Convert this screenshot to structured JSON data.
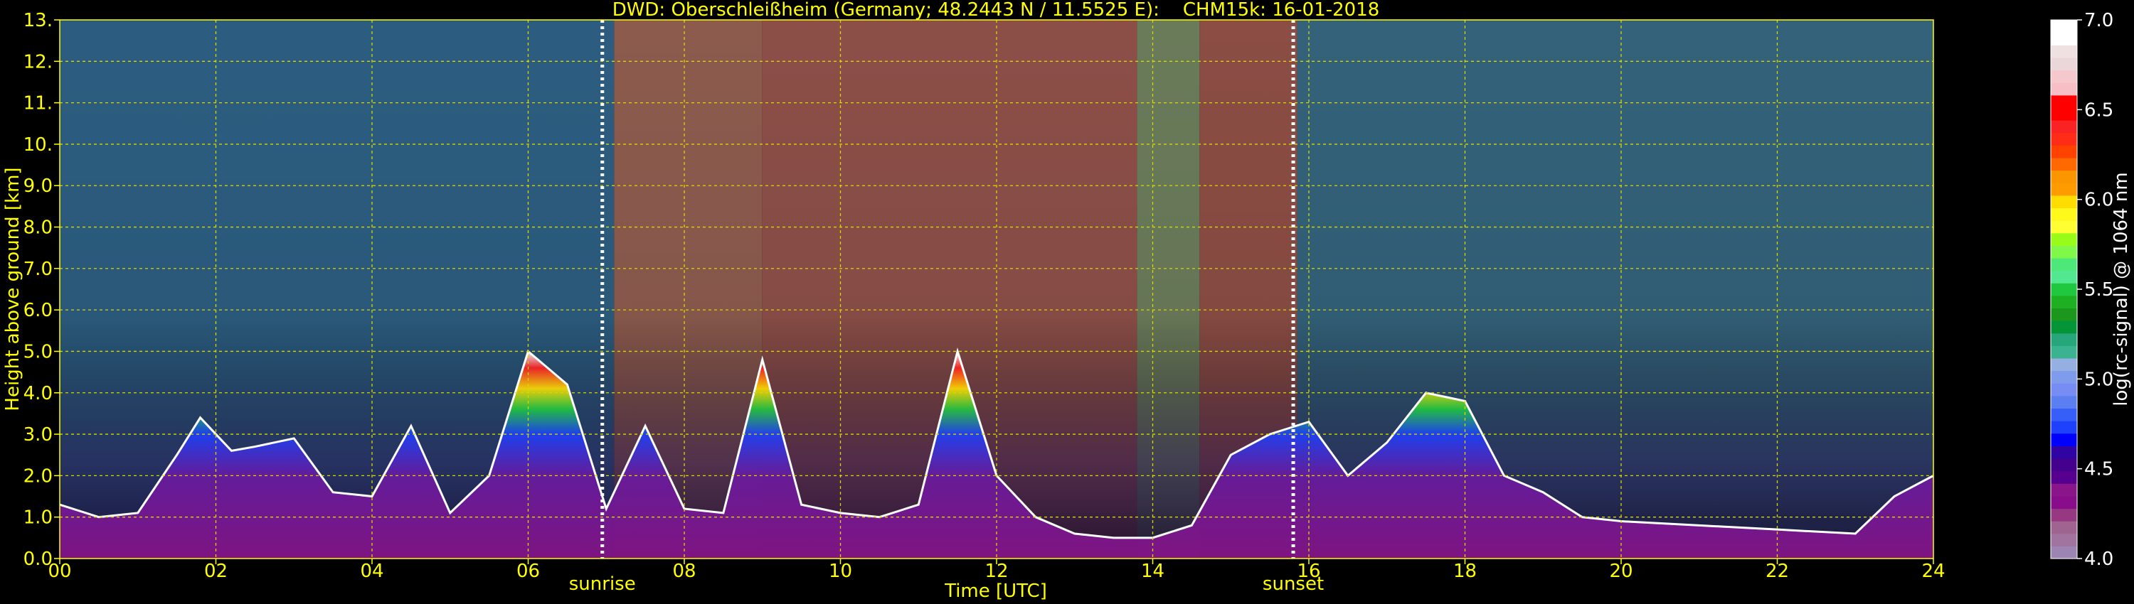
{
  "chart_data": {
    "type": "heatmap",
    "title": "DWD: Oberschleißheim (Germany; 48.2443 N / 11.5525 E):    CHM15k: 16-01-2018",
    "xlabel": "Time [UTC]",
    "ylabel": "Height above ground [km]",
    "xlim": [
      0,
      24
    ],
    "ylim": [
      0,
      13
    ],
    "x_ticks": [
      "00",
      "02",
      "04",
      "06",
      "08",
      "10",
      "12",
      "14",
      "16",
      "18",
      "20",
      "22",
      "24"
    ],
    "y_ticks": [
      "0.0",
      "1.0",
      "2.0",
      "3.0",
      "4.0",
      "5.0",
      "6.0",
      "7.0",
      "8.0",
      "9.0",
      "10.",
      "11.",
      "12.",
      "13."
    ],
    "grid": true,
    "annotations": [
      {
        "label": "sunrise",
        "x": 6.95
      },
      {
        "label": "sunset",
        "x": 15.8
      }
    ],
    "colorbar": {
      "label": "log(rc-signal) @ 1064 nm",
      "range": [
        4.0,
        7.0
      ],
      "ticks": [
        "4.0",
        "4.5",
        "5.0",
        "5.5",
        "6.0",
        "6.5",
        "7.0"
      ],
      "colors": [
        "#9c85b4",
        "#a1749f",
        "#a06490",
        "#973883",
        "#880d8a",
        "#8a148a",
        "#57008f",
        "#44018d",
        "#2f04a2",
        "#0000ff",
        "#1d41fd",
        "#365ffa",
        "#5b7ff0",
        "#778df3",
        "#7f9beb",
        "#95afe2",
        "#3bb391",
        "#27a57b",
        "#039537",
        "#1b971d",
        "#1eaf22",
        "#20c840",
        "#51e88f",
        "#4de877",
        "#80f84a",
        "#99fb18",
        "#ffff33",
        "#fff81a",
        "#ffdd00",
        "#fe9b00",
        "#fb9600",
        "#ff6900",
        "#ff4200",
        "#ff2c17",
        "#fa2222",
        "#ff0000",
        "#ff0000",
        "#f7bfc5",
        "#f5c8cd",
        "#ebd7d9",
        "#efe1e1",
        "#ffffff",
        "#ffffff"
      ]
    },
    "background_regimes": [
      {
        "from": 0,
        "to": 7.1,
        "color": "#2c5d80"
      },
      {
        "from": 7.1,
        "to": 9.0,
        "color": "#8c5b4e"
      },
      {
        "from": 9.0,
        "to": 13.8,
        "color": "#8c4f48"
      },
      {
        "from": 13.8,
        "to": 14.6,
        "color": "#6a7b5a"
      },
      {
        "from": 14.6,
        "to": 15.85,
        "color": "#8b4d44"
      },
      {
        "from": 15.85,
        "to": 24,
        "color": "#33627a"
      }
    ],
    "boundary_layer_top_km": [
      [
        0.0,
        1.3
      ],
      [
        0.5,
        1.0
      ],
      [
        1.0,
        1.1
      ],
      [
        1.5,
        2.5
      ],
      [
        1.8,
        3.4
      ],
      [
        2.2,
        2.6
      ],
      [
        2.5,
        2.7
      ],
      [
        3.0,
        2.9
      ],
      [
        3.5,
        1.6
      ],
      [
        4.0,
        1.5
      ],
      [
        4.5,
        3.2
      ],
      [
        5.0,
        1.1
      ],
      [
        5.5,
        2.0
      ],
      [
        6.0,
        5.0
      ],
      [
        6.5,
        4.2
      ],
      [
        7.0,
        1.2
      ],
      [
        7.5,
        3.2
      ],
      [
        8.0,
        1.2
      ],
      [
        8.5,
        1.1
      ],
      [
        9.0,
        4.8
      ],
      [
        9.5,
        1.3
      ],
      [
        10.0,
        1.1
      ],
      [
        10.5,
        1.0
      ],
      [
        11.0,
        1.3
      ],
      [
        11.5,
        5.0
      ],
      [
        12.0,
        2.0
      ],
      [
        12.5,
        1.0
      ],
      [
        13.0,
        0.6
      ],
      [
        13.5,
        0.5
      ],
      [
        14.0,
        0.5
      ],
      [
        14.5,
        0.8
      ],
      [
        15.0,
        2.5
      ],
      [
        15.5,
        3.0
      ],
      [
        16.0,
        3.3
      ],
      [
        16.5,
        2.0
      ],
      [
        17.0,
        2.8
      ],
      [
        17.5,
        4.0
      ],
      [
        18.0,
        3.8
      ],
      [
        18.5,
        2.0
      ],
      [
        19.0,
        1.6
      ],
      [
        19.5,
        1.0
      ],
      [
        20.0,
        0.9
      ],
      [
        21.0,
        0.8
      ],
      [
        22.0,
        0.7
      ],
      [
        23.0,
        0.6
      ],
      [
        23.5,
        1.5
      ],
      [
        24.0,
        2.0
      ]
    ]
  }
}
